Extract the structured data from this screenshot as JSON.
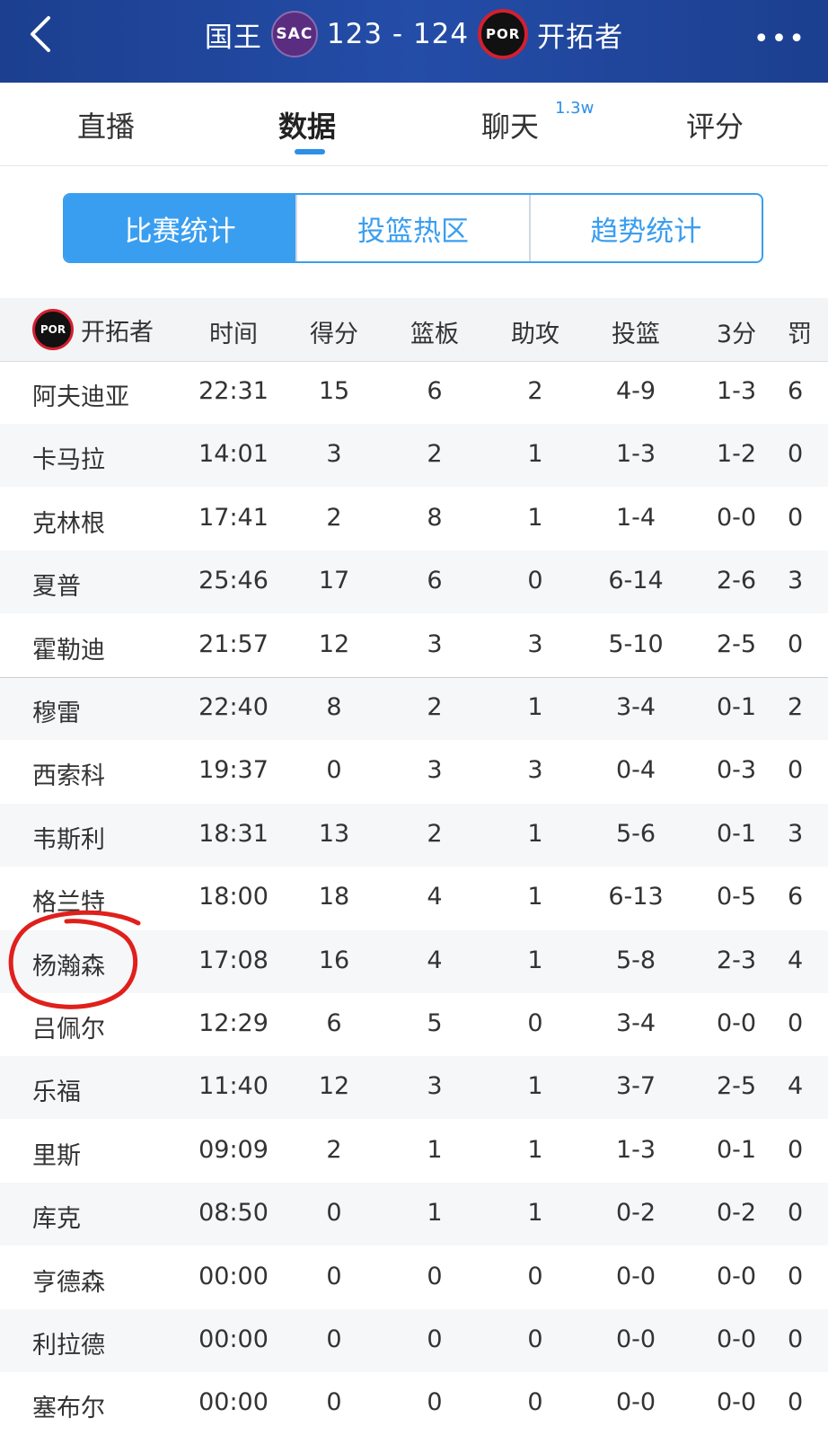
{
  "header": {
    "home_team": "国王",
    "home_abbr": "SAC",
    "score": "123 - 124",
    "away_abbr": "POR",
    "away_team": "开拓者"
  },
  "tabs": [
    {
      "label": "直播"
    },
    {
      "label": "数据"
    },
    {
      "label": "聊天",
      "badge": "1.3w"
    },
    {
      "label": "评分"
    }
  ],
  "segments": [
    "比赛统计",
    "投篮热区",
    "趋势统计"
  ],
  "table": {
    "team_label": "开拓者",
    "columns": [
      "时间",
      "得分",
      "篮板",
      "助攻",
      "投篮",
      "3分",
      "罚"
    ],
    "rows": [
      [
        "阿夫迪亚",
        "22:31",
        "15",
        "6",
        "2",
        "4-9",
        "1-3",
        "6"
      ],
      [
        "卡马拉",
        "14:01",
        "3",
        "2",
        "1",
        "1-3",
        "1-2",
        "0"
      ],
      [
        "克林根",
        "17:41",
        "2",
        "8",
        "1",
        "1-4",
        "0-0",
        "0"
      ],
      [
        "夏普",
        "25:46",
        "17",
        "6",
        "0",
        "6-14",
        "2-6",
        "3"
      ],
      [
        "霍勒迪",
        "21:57",
        "12",
        "3",
        "3",
        "5-10",
        "2-5",
        "0"
      ],
      [
        "穆雷",
        "22:40",
        "8",
        "2",
        "1",
        "3-4",
        "0-1",
        "2"
      ],
      [
        "西索科",
        "19:37",
        "0",
        "3",
        "3",
        "0-4",
        "0-3",
        "0"
      ],
      [
        "韦斯利",
        "18:31",
        "13",
        "2",
        "1",
        "5-6",
        "0-1",
        "3"
      ],
      [
        "格兰特",
        "18:00",
        "18",
        "4",
        "1",
        "6-13",
        "0-5",
        "6"
      ],
      [
        "杨瀚森",
        "17:08",
        "16",
        "4",
        "1",
        "5-8",
        "2-3",
        "4"
      ],
      [
        "吕佩尔",
        "12:29",
        "6",
        "5",
        "0",
        "3-4",
        "0-0",
        "0"
      ],
      [
        "乐福",
        "11:40",
        "12",
        "3",
        "1",
        "3-7",
        "2-5",
        "4"
      ],
      [
        "里斯",
        "09:09",
        "2",
        "1",
        "1",
        "1-3",
        "0-1",
        "0"
      ],
      [
        "库克",
        "08:50",
        "0",
        "1",
        "1",
        "0-2",
        "0-2",
        "0"
      ],
      [
        "亨德森",
        "00:00",
        "0",
        "0",
        "0",
        "0-0",
        "0-0",
        "0"
      ],
      [
        "利拉德",
        "00:00",
        "0",
        "0",
        "0",
        "0-0",
        "0-0",
        "0"
      ],
      [
        "塞布尔",
        "00:00",
        "0",
        "0",
        "0",
        "0-0",
        "0-0",
        "0"
      ]
    ]
  },
  "colors": {
    "header_bg": "#244da8",
    "accent": "#3a9ef0",
    "mark": "#e0201c"
  }
}
